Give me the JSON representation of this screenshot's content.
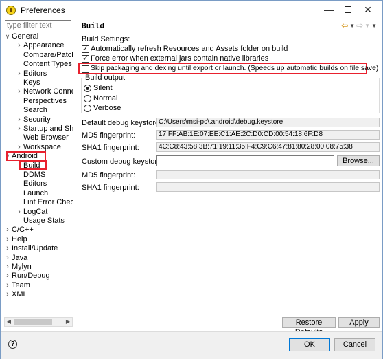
{
  "window": {
    "title": "Preferences"
  },
  "filter": {
    "placeholder": "type filter text"
  },
  "tree": [
    {
      "label": "General",
      "indent": 0,
      "arrow": "expanded"
    },
    {
      "label": "Appearance",
      "indent": 1,
      "arrow": "collapsed"
    },
    {
      "label": "Compare/Patch",
      "indent": 1,
      "arrow": "none"
    },
    {
      "label": "Content Types",
      "indent": 1,
      "arrow": "none"
    },
    {
      "label": "Editors",
      "indent": 1,
      "arrow": "collapsed"
    },
    {
      "label": "Keys",
      "indent": 1,
      "arrow": "none"
    },
    {
      "label": "Network Connec",
      "indent": 1,
      "arrow": "collapsed"
    },
    {
      "label": "Perspectives",
      "indent": 1,
      "arrow": "none"
    },
    {
      "label": "Search",
      "indent": 1,
      "arrow": "none"
    },
    {
      "label": "Security",
      "indent": 1,
      "arrow": "collapsed"
    },
    {
      "label": "Startup and Shut",
      "indent": 1,
      "arrow": "collapsed"
    },
    {
      "label": "Web Browser",
      "indent": 1,
      "arrow": "none"
    },
    {
      "label": "Workspace",
      "indent": 1,
      "arrow": "collapsed"
    },
    {
      "label": "Android",
      "indent": 0,
      "arrow": "expanded"
    },
    {
      "label": "Build",
      "indent": 1,
      "arrow": "none"
    },
    {
      "label": "DDMS",
      "indent": 1,
      "arrow": "none"
    },
    {
      "label": "Editors",
      "indent": 1,
      "arrow": "none"
    },
    {
      "label": "Launch",
      "indent": 1,
      "arrow": "none"
    },
    {
      "label": "Lint Error Checkir",
      "indent": 1,
      "arrow": "none"
    },
    {
      "label": "LogCat",
      "indent": 1,
      "arrow": "collapsed"
    },
    {
      "label": "Usage Stats",
      "indent": 1,
      "arrow": "none"
    },
    {
      "label": "C/C++",
      "indent": 0,
      "arrow": "collapsed"
    },
    {
      "label": "Help",
      "indent": 0,
      "arrow": "collapsed"
    },
    {
      "label": "Install/Update",
      "indent": 0,
      "arrow": "collapsed"
    },
    {
      "label": "Java",
      "indent": 0,
      "arrow": "collapsed"
    },
    {
      "label": "Mylyn",
      "indent": 0,
      "arrow": "collapsed"
    },
    {
      "label": "Run/Debug",
      "indent": 0,
      "arrow": "collapsed"
    },
    {
      "label": "Team",
      "indent": 0,
      "arrow": "collapsed"
    },
    {
      "label": "XML",
      "indent": 0,
      "arrow": "collapsed"
    }
  ],
  "page": {
    "title": "Build",
    "settings_label": "Build Settings:",
    "checkboxes": [
      {
        "label": "Automatically refresh Resources and Assets folder on build",
        "checked": true
      },
      {
        "label": "Force error when external jars contain native libraries",
        "checked": true
      },
      {
        "label": "Skip packaging and dexing until export or launch. (Speeds up automatic builds on file save)",
        "checked": false
      }
    ],
    "output_group": {
      "title": "Build output",
      "options": [
        {
          "label": "Silent",
          "selected": true
        },
        {
          "label": "Normal",
          "selected": false
        },
        {
          "label": "Verbose",
          "selected": false
        }
      ]
    },
    "fields": {
      "default_keystore_label": "Default debug keystore:",
      "default_keystore_value": "C:\\Users\\msi-pc\\.android\\debug.keystore",
      "md5_label": "MD5 fingerprint:",
      "md5_value": "17:FF:AB:1E:07:EE:C1:AE:2C:D0:CD:00:54:18:6F:D8",
      "sha1_label": "SHA1 fingerprint:",
      "sha1_value": "4C:C8:43:58:3B:71:19:11:35:F4:C9:C6:47:81:80:28:00:08:75:38",
      "custom_keystore_label": "Custom debug keystore:",
      "custom_keystore_value": "",
      "browse_label": "Browse...",
      "custom_md5_label": "MD5 fingerprint:",
      "custom_sha1_label": "SHA1 fingerprint:"
    },
    "restore_defaults_label": "Restore Defaults",
    "apply_label": "Apply"
  },
  "footer": {
    "ok_label": "OK",
    "cancel_label": "Cancel",
    "help_glyph": "?"
  },
  "colors": {
    "highlight": "#e8212e",
    "accent": "#0078d7"
  }
}
